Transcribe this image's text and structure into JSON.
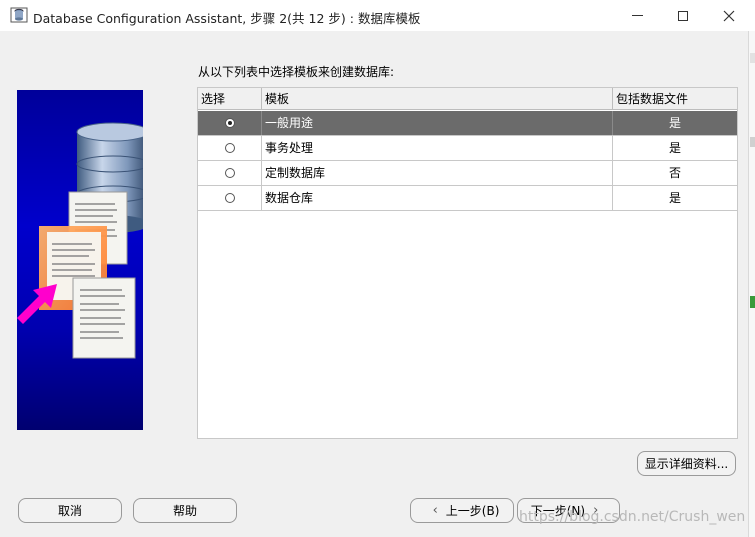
{
  "window": {
    "title": "Database Configuration Assistant, 步骤 2(共 12 步) : 数据库模板"
  },
  "heading": "从以下列表中选择模板来创建数据库:",
  "table": {
    "columns": [
      "选择",
      "模板",
      "包括数据文件"
    ],
    "rows": [
      {
        "template": "一般用途",
        "includes_datafiles": "是",
        "selected": true
      },
      {
        "template": "事务处理",
        "includes_datafiles": "是",
        "selected": false
      },
      {
        "template": "定制数据库",
        "includes_datafiles": "否",
        "selected": false
      },
      {
        "template": "数据仓库",
        "includes_datafiles": "是",
        "selected": false
      }
    ]
  },
  "buttons": {
    "details": "显示详细资料...",
    "cancel": "取消",
    "help": "帮助",
    "back": "上一步(B)",
    "next": "下一步(N)"
  },
  "watermark": "https://blog.csdn.net/Crush_wen",
  "colors": {
    "selected_row": "#6b6b6b",
    "side_art_blue": "#0000cc",
    "arrow_magenta": "#ff00cc"
  }
}
